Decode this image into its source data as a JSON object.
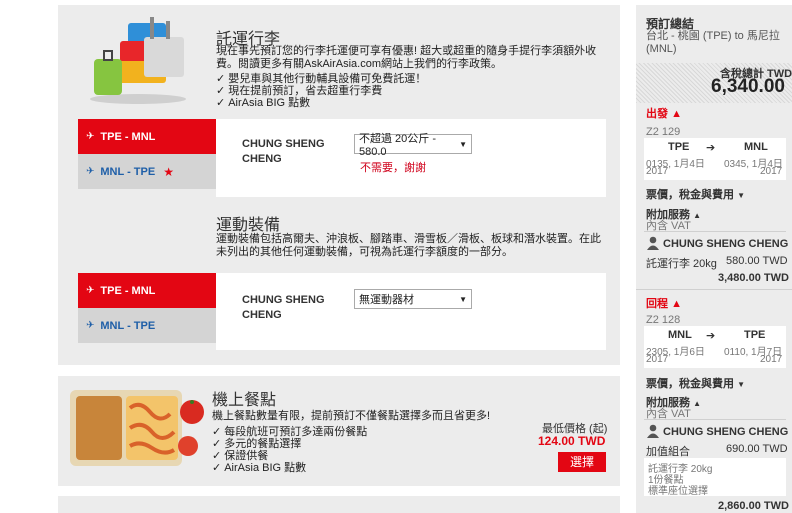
{
  "baggage": {
    "title": "託運行李",
    "description": "現在事先預訂您的行李托運便可享有優惠! 超大或超重的隨身手提行李須額外收費。閱讀更多有關AskAirAsia.com網站上我們的行李政策。",
    "checks": [
      "嬰兒車與其他行動輔具設備可免費託運！",
      "現在提前預訂，省去超重行李費",
      "AirAsia BIG 點數"
    ],
    "routes": [
      {
        "label": "TPE - MNL"
      },
      {
        "label": "MNL - TPE"
      }
    ],
    "passenger": "CHUNG SHENG CHENG",
    "selected_option": "不超過 20公斤 - 580.0",
    "decline_link": "不需要，謝謝"
  },
  "sports": {
    "title": "運動裝備",
    "description": "運動裝備包括高爾夫、沖浪板、腳踏車、滑雪板／滑板、板球和潛水裝置。在此未列出的其他任何運動裝備，可視為託運行李額度的一部分。",
    "routes": [
      {
        "label": "TPE - MNL"
      },
      {
        "label": "MNL - TPE"
      }
    ],
    "passenger": "CHUNG SHENG CHENG",
    "selected_option": "無運動器材"
  },
  "meal": {
    "title": "機上餐點",
    "description": "機上餐點數量有限，提前預訂不僅餐點選擇多而且省更多!",
    "checks": [
      "每段航班可預訂多達兩份餐點",
      "多元的餐點選擇",
      "保證供餐",
      "AirAsia BIG 點數"
    ],
    "price_label": "最低價格 (起)",
    "price": "124.00 TWD",
    "select_button": "選擇"
  },
  "summary": {
    "title": "預訂總結",
    "route": "台北 - 桃園 (TPE) to 馬尼拉 (MNL)",
    "total_label": "含稅總計 TWD",
    "total": "6,340.00",
    "outbound": {
      "label": "出發",
      "flight_no": "Z2 129",
      "from_code": "TPE",
      "to_code": "MNL",
      "dep_time": "0135, 1月4日",
      "dep_year": "2017",
      "arr_time": "0345, 1月4日",
      "arr_year": "2017",
      "fares_label": "票價，稅金與費用",
      "addons_label": "附加服務",
      "vat_label": "內含 VAT",
      "passenger": "CHUNG SHENG CHENG",
      "item_label": "託運行李 20kg",
      "item_price": "580.00 TWD",
      "subtotal": "3,480.00 TWD"
    },
    "return": {
      "label": "回程",
      "flight_no": "Z2 128",
      "from_code": "MNL",
      "to_code": "TPE",
      "dep_time": "2305, 1月6日",
      "dep_year": "2017",
      "arr_time": "0110, 1月7日",
      "arr_year": "2017",
      "fares_label": "票價，稅金與費用",
      "addons_label": "附加服務",
      "vat_label": "內含 VAT",
      "passenger": "CHUNG SHENG CHENG",
      "combo_label": "加值組合",
      "combo_price": "690.00 TWD",
      "combo_items": [
        "託運行李 20kg",
        "1份餐點",
        "標準座位選擇"
      ],
      "subtotal": "2,860.00 TWD"
    }
  },
  "colors": {
    "accent": "#e30613",
    "link": "#1f5fa8"
  }
}
